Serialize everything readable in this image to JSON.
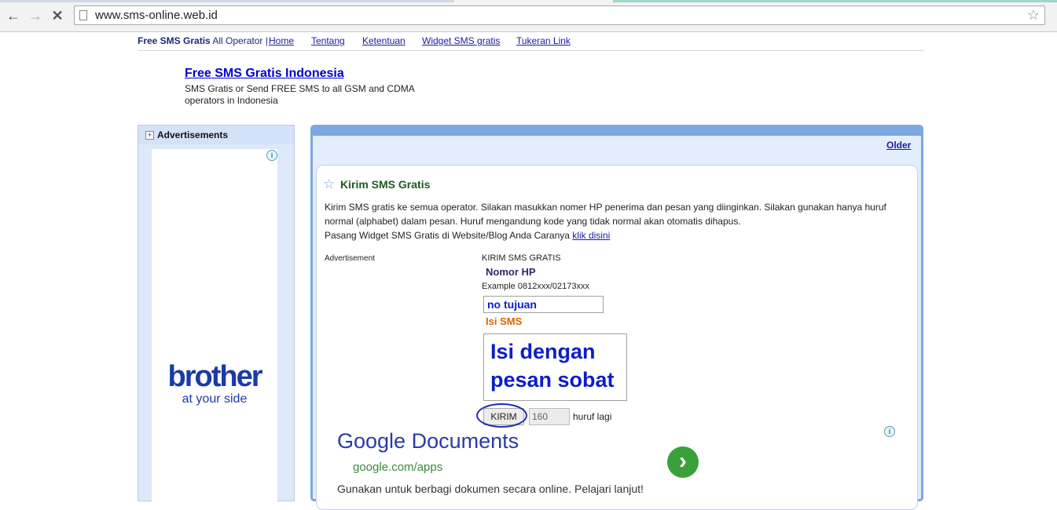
{
  "browser": {
    "url": "www.sms-online.web.id",
    "icons": {
      "back": "back-arrow-icon",
      "forward": "forward-arrow-icon",
      "stop": "close-icon",
      "page": "page-icon",
      "bookmark": "star-icon"
    }
  },
  "topnav": {
    "brand_bold": "Free SMS Gratis",
    "brand_rest": " All Operator | ",
    "links": [
      "Home",
      "Tentang",
      "Ketentuan",
      "Widget SMS gratis",
      "Tukeran Link"
    ]
  },
  "header": {
    "title": "Free SMS Gratis Indonesia",
    "description": "SMS Gratis or Send FREE SMS to all GSM and CDMA operators in Indonesia"
  },
  "sidebar": {
    "title": "Advertisements",
    "ad": {
      "brand": "brother",
      "tagline": "at your side"
    }
  },
  "main": {
    "older_link": "Older",
    "post": {
      "title": "Kirim SMS Gratis",
      "body_line1": "Kirim SMS gratis ke semua operator. Silakan masukkan nomer HP penerima dan pesan yang diinginkan. Silakan gunakan hanya huruf normal (alphabet) dalam pesan. Huruf mengandung kode yang tidak normal akan otomatis dihapus.",
      "body_line2": "Pasang Widget SMS Gratis di Website/Blog Anda Caranya ",
      "body_link": "klik disini",
      "advert_label": "Advertisement"
    },
    "form": {
      "title": "KIRIM SMS GRATIS",
      "nomor_label": "Nomor HP",
      "example": "Example 0812xxx/02173xxx",
      "phone_value": "no tujuan",
      "isi_label": "Isi SMS",
      "message_value": "Isi dengan pesan sobat",
      "submit_label": "KIRIM",
      "counter_value": "160",
      "counter_suffix": "huruf lagi"
    },
    "google_ad": {
      "title": "Google Documents",
      "url": "google.com/apps",
      "description": "Gunakan untuk berbagi dokumen secara online. Pelajari lanjut!",
      "go_icon": "chevron-right-icon"
    }
  },
  "colors": {
    "accent_blue": "#7ea6e0",
    "link": "#1a1aa6",
    "post_title": "#1e5a1e",
    "isi_label": "#e05e00",
    "annotation_circle": "#1b2bb8",
    "ad_green": "#3aa03a"
  }
}
